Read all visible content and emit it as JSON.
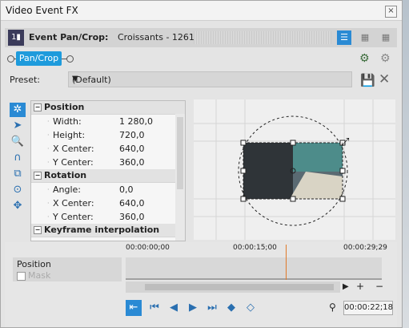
{
  "window": {
    "title": "Video Event FX",
    "close_label": "×"
  },
  "header": {
    "plugin_name": "Event Pan/Crop:",
    "media_name": "Croissants - 1261"
  },
  "chain": {
    "chip_label": "Pan/Crop"
  },
  "preset": {
    "label": "Preset:",
    "value": "(Default)"
  },
  "properties": {
    "sections": [
      {
        "title": "Position",
        "rows": [
          {
            "key": "Width:",
            "value": "1 280,0"
          },
          {
            "key": "Height:",
            "value": "720,0"
          },
          {
            "key": "X Center:",
            "value": "640,0"
          },
          {
            "key": "Y Center:",
            "value": "360,0"
          }
        ]
      },
      {
        "title": "Rotation",
        "rows": [
          {
            "key": "Angle:",
            "value": "0,0"
          },
          {
            "key": "X Center:",
            "value": "640,0"
          },
          {
            "key": "Y Center:",
            "value": "360,0"
          }
        ]
      },
      {
        "title": "Keyframe interpolation",
        "rows": []
      }
    ]
  },
  "timeline": {
    "track_name": "Position",
    "mask_label": "Mask",
    "ruler_labels": [
      "00:00:00;00",
      "00:00:15;00",
      "00:00:29;29"
    ],
    "timecode": "00:00:22;18"
  },
  "colors": {
    "accent": "#2a8ad4",
    "chip": "#1e9bdc",
    "cursor": "#e07a2a"
  }
}
